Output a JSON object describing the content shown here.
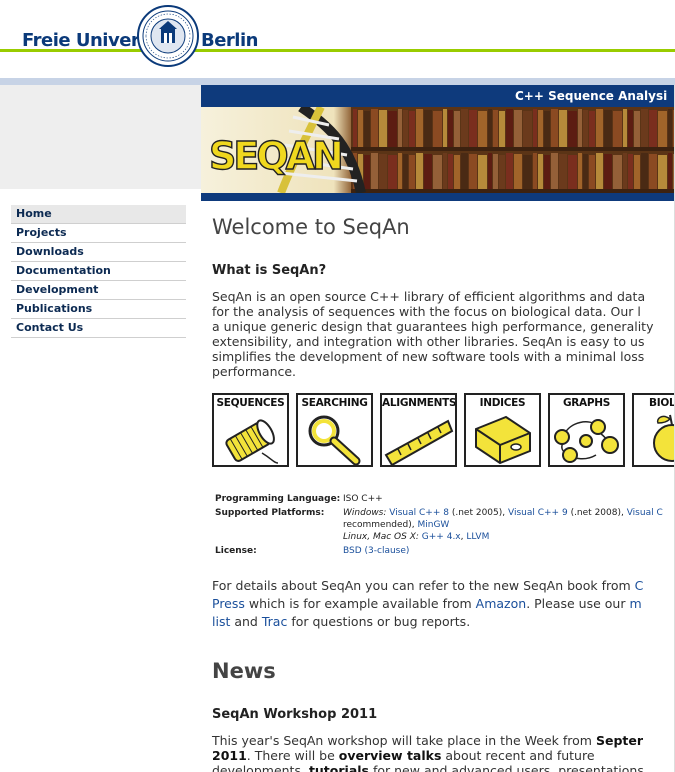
{
  "header": {
    "wordmark_left": "Freie Universität",
    "wordmark_right": "Berlin",
    "seal_text": "VERITAS · IUSTITIA · LIBERTAS"
  },
  "nav": {
    "items": [
      {
        "label": "Home"
      },
      {
        "label": "Projects"
      },
      {
        "label": "Downloads"
      },
      {
        "label": "Documentation"
      },
      {
        "label": "Development"
      },
      {
        "label": "Publications"
      },
      {
        "label": "Contact Us"
      }
    ]
  },
  "banner": {
    "title": "C++ Sequence Analysi",
    "logo_text": "SEQAN"
  },
  "main": {
    "page_title": "Welcome to SeqAn",
    "what_heading": "What is SeqAn?",
    "intro_lines": [
      "SeqAn is an open source C++ library of efficient algorithms and data",
      "for the analysis of sequences with the focus on biological data. Our l",
      "a unique generic design that guarantees high performance, generality",
      "extensibility, and integration with other libraries. SeqAn is easy to us",
      "simplifies the development of new software tools with a minimal loss",
      "performance."
    ],
    "tiles": [
      {
        "label": "SEQUENCES"
      },
      {
        "label": "SEARCHING"
      },
      {
        "label": "ALIGNMENTS"
      },
      {
        "label": "INDICES"
      },
      {
        "label": "GRAPHS"
      },
      {
        "label": "BIOLOG"
      }
    ],
    "info": {
      "lang_key": "Programming Language:",
      "lang_val": "ISO C++",
      "platforms_key": "Supported Platforms:",
      "win_label": "Windows:",
      "vc8": "Visual C++ 8",
      "vc8_note": "(.net 2005),",
      "vc9": "Visual C++ 9",
      "vc9_note": "(.net 2008),",
      "vc_more": "Visual C",
      "recommended": "recommended),",
      "mingw": "MinGW",
      "unix_label": "Linux, Mac OS X:",
      "gpp": "G++ 4.x",
      "llvm": "LLVM",
      "license_key": "License:",
      "license_val": "BSD (3-clause)"
    },
    "details": {
      "line1_text": "For details about SeqAn you can refer to the new SeqAn book from",
      "line1_link": "C",
      "line2_link1": "Press",
      "line2_text": "which is for example available from",
      "line2_link2": "Amazon",
      "line2_text2": ". Please use our",
      "line2_link3": "m",
      "line3_link1": "list",
      "line3_text1": "and",
      "line3_link2": "Trac",
      "line3_text2": "for questions or bug reports."
    },
    "news_heading": "News",
    "workshop_heading": "SeqAn Workshop 2011",
    "workshop": {
      "l1_text": "This year's SeqAn workshop will take place in the Week from",
      "l1_bold": "Septer",
      "l2_bold": "2011",
      "l2_text": ". There will be",
      "l2_bold2": "overview talks",
      "l2_text2": "about recent and future",
      "l3_text": "developments,",
      "l3_bold": "tutorials",
      "l3_text2": "for new and advanced users, presentations"
    }
  },
  "colors": {
    "fu_blue": "#0b3a7a",
    "fu_green": "#99cc00",
    "banner_blue": "#0e3a7c",
    "link": "#1a4f9b",
    "tile_yellow": "#f3e33a"
  }
}
